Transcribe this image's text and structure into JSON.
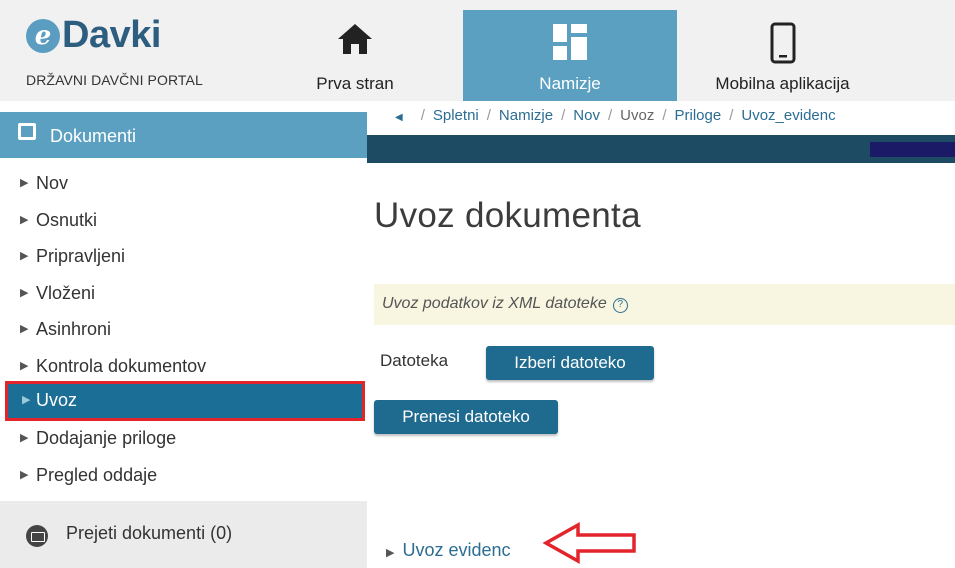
{
  "header": {
    "logo_mark": "e",
    "logo_text": "Davki",
    "logo_subtitle": "DRŽAVNI DAVČNI PORTAL",
    "nav": [
      {
        "label": "Prva stran",
        "icon": "home-icon"
      },
      {
        "label": "Namizje",
        "icon": "dashboard-icon",
        "active": true
      },
      {
        "label": "Mobilna aplikacija",
        "icon": "mobile-phone-icon"
      }
    ]
  },
  "sidebar": {
    "header_label": "Dokumenti",
    "items": [
      {
        "label": "Nov"
      },
      {
        "label": "Osnutki"
      },
      {
        "label": "Pripravljeni"
      },
      {
        "label": "Vloženi"
      },
      {
        "label": "Asinhroni"
      },
      {
        "label": "Kontrola dokumentov"
      },
      {
        "label": "Uvoz",
        "active": true
      },
      {
        "label": "Dodajanje priloge"
      },
      {
        "label": "Pregled oddaje"
      }
    ],
    "footer_label": "Prejeti dokumenti (0)"
  },
  "breadcrumb": {
    "items": [
      "Spletni",
      "Namizje",
      "Nov",
      "Uvoz",
      "Priloge",
      "Uvoz_evidenc"
    ]
  },
  "main": {
    "title": "Uvoz dokumenta",
    "info_text": "Uvoz podatkov iz XML datoteke",
    "file_label": "Datoteka",
    "pick_button": "Izberi datoteko",
    "upload_button": "Prenesi datoteko",
    "evidenc_link": "Uvoz evidenc"
  },
  "colors": {
    "accent": "#5ba0c1",
    "active_item": "#1b6f96",
    "button": "#1f6a8f",
    "highlight_border": "#e3242b",
    "info_bg": "#f8f6e0"
  }
}
